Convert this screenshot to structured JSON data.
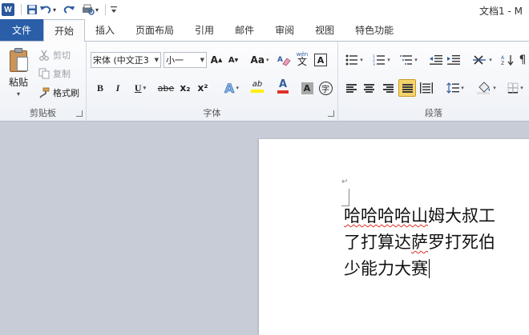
{
  "titlebar": {
    "title": "文档1 - M"
  },
  "tabs": [
    {
      "label": "文件"
    },
    {
      "label": "开始"
    },
    {
      "label": "插入"
    },
    {
      "label": "页面布局"
    },
    {
      "label": "引用"
    },
    {
      "label": "邮件"
    },
    {
      "label": "审阅"
    },
    {
      "label": "视图"
    },
    {
      "label": "特色功能"
    }
  ],
  "clipboard": {
    "paste_label": "粘贴",
    "cut_label": "剪切",
    "copy_label": "复制",
    "format_painter_label": "格式刷",
    "group_label": "剪贴板"
  },
  "font": {
    "font_name": "宋体 (中文正3",
    "font_size": "小一",
    "grow_label": "A",
    "shrink_label": "A",
    "change_case_label": "Aa",
    "bold_label": "B",
    "italic_label": "I",
    "underline_label": "U",
    "strike_label": "abe",
    "subscript_label": "x₂",
    "superscript_label": "x²",
    "text_effect_label": "A",
    "highlight_label": "ab",
    "font_color_label": "A",
    "char_shading_label": "A",
    "enclose_label": "字",
    "phonetic_label": "wén",
    "phonetic_char": "文",
    "border_label": "A",
    "group_label": "字体"
  },
  "paragraph": {
    "group_label": "段落"
  },
  "document": {
    "line1_a": "哈哈哈哈山",
    "line1_b": "姆大叔",
    "line1_c": "工",
    "line2_a": "了打算达",
    "line2_b": "萨",
    "line2_c": "罗打死",
    "line2_d": "伯",
    "line3": "少能力大赛"
  },
  "colors": {
    "file_tab": "#2a5ea8",
    "highlight": "#ffef00",
    "font_color": "#e0302b",
    "spell_error": "#e0302b",
    "active_toggle": "#f6d36b"
  }
}
